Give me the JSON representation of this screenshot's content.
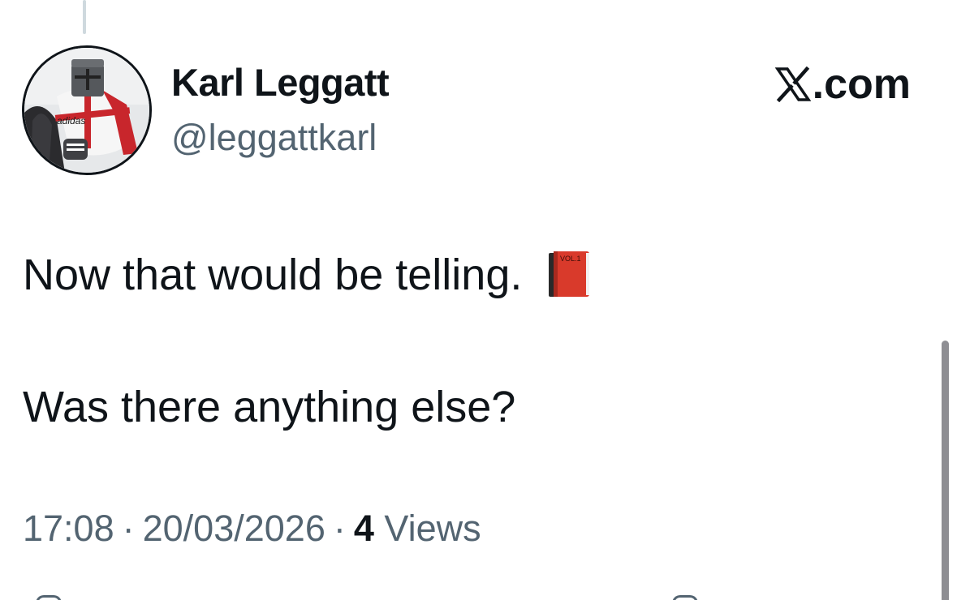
{
  "post": {
    "author": {
      "display_name": "Karl Leggatt",
      "handle": "@leggattkarl",
      "avatar_icon": "knight-avatar-icon",
      "avatar_logo_text": "adidas"
    },
    "brand": {
      "text": ".com",
      "icon": "x-logo-icon"
    },
    "body": {
      "line_1": "Now that would be telling.",
      "emoji_icon": "red-book-icon",
      "emoji_label": "VOL.1",
      "line_2": "Was there anything else?"
    },
    "meta": {
      "time": "17:08",
      "separator": "·",
      "date": "20/03/2026",
      "views_count": "4",
      "views_label": "Views"
    }
  },
  "colors": {
    "text_primary": "#0f1419",
    "text_secondary": "#536471",
    "thread_line": "#cfd9de",
    "book_red": "#d93a2b",
    "background": "#ffffff"
  }
}
